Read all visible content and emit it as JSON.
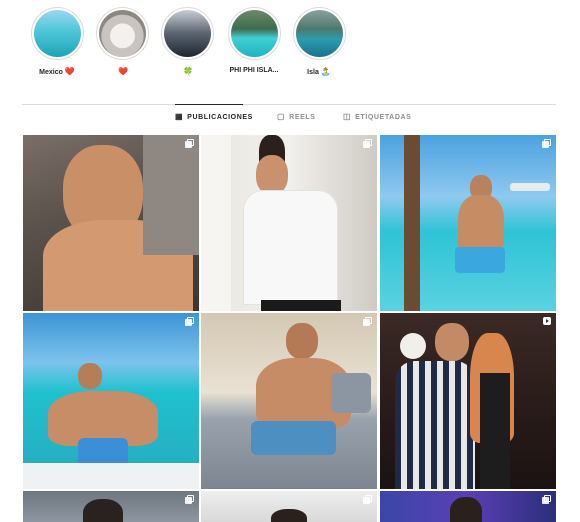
{
  "highlights": [
    {
      "label": "Mexico",
      "emoji": "❤️",
      "icon": "heart-emoji"
    },
    {
      "label": "",
      "emoji": "❤️",
      "icon": "heart-emoji"
    },
    {
      "label": "",
      "emoji": "🍀",
      "icon": "clover-emoji"
    },
    {
      "label": "PHI PHI ISLA...",
      "emoji": "",
      "icon": ""
    },
    {
      "label": "Isla",
      "emoji": "🏝️",
      "icon": "island-emoji"
    }
  ],
  "tabs": [
    {
      "label": "PUBLICACIONES",
      "icon": "grid-icon",
      "active": true
    },
    {
      "label": "REELS",
      "icon": "reels-icon",
      "active": false
    },
    {
      "label": "ETIQUETADAS",
      "icon": "tagged-icon",
      "active": false
    }
  ],
  "posts": [
    {
      "type": "carousel",
      "icon": "carousel-icon"
    },
    {
      "type": "carousel",
      "icon": "carousel-icon"
    },
    {
      "type": "carousel",
      "icon": "carousel-icon"
    },
    {
      "type": "carousel",
      "icon": "carousel-icon"
    },
    {
      "type": "carousel",
      "icon": "carousel-icon"
    },
    {
      "type": "reel",
      "icon": "reel-icon"
    },
    {
      "type": "carousel",
      "icon": "carousel-icon"
    },
    {
      "type": "carousel",
      "icon": "carousel-icon"
    },
    {
      "type": "carousel",
      "icon": "carousel-icon"
    }
  ],
  "colors": {
    "divider": "#dbdbdb",
    "text": "#262626",
    "muted": "#8e8e8e",
    "sea": "#2ec4d6",
    "sky": "#4aa3df",
    "skin": "#d9a07a"
  }
}
